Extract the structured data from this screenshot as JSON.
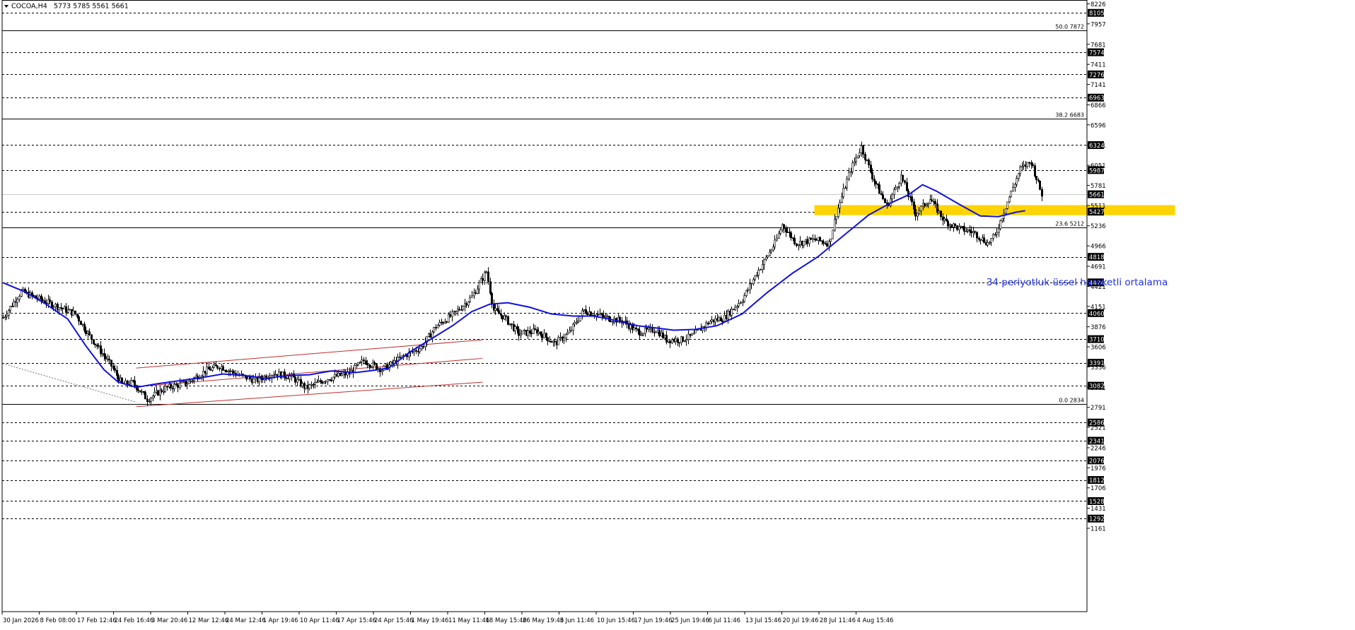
{
  "window": {
    "title": "COCOA,H4",
    "ohlc": "5773 5785 5561 5661"
  },
  "annotation": "34 periyotluk üssel hareketli ortalama",
  "colors": {
    "ema": "#1010e0",
    "channel": "#c03030",
    "zone": "#ffd400",
    "candle": "#000000",
    "annotation": "#2030e0"
  },
  "chart_data": {
    "type": "candlestick",
    "symbol": "COCOA",
    "timeframe": "H4",
    "ylim": [
      1161,
      8226
    ],
    "price_ticks": [
      8226,
      7957,
      7681,
      7411,
      7141,
      6866,
      6596,
      6321,
      6051,
      5781,
      5511,
      5236,
      4966,
      4691,
      4421,
      4151,
      3876,
      3606,
      3336,
      3061,
      2791,
      2521,
      2246,
      1976,
      1706,
      1431,
      1161
    ],
    "horizontal_levels": [
      8105,
      7574,
      7276,
      6963,
      6324,
      5987,
      5427,
      4818,
      4474,
      4060,
      3710,
      3391,
      3082,
      2586,
      2341,
      2076,
      1812,
      1528,
      1292
    ],
    "current_price": 5661,
    "fibonacci": [
      {
        "label": "50.0 7872",
        "value": 7872
      },
      {
        "label": "38.2 6683",
        "value": 6683
      },
      {
        "label": "23.6 5212",
        "value": 5212
      },
      {
        "label": "0.0 2834",
        "value": 2834
      }
    ],
    "x_labels": [
      "30 Jan 2026",
      "8 Feb 08:00",
      "17 Feb 12:46",
      "24 Feb 16:46",
      "3 Mar 20:46",
      "12 Mar 12:46",
      "24 Mar 12:46",
      "1 Apr 19:46",
      "10 Apr 11:46",
      "17 Apr 15:46",
      "24 Apr 15:46",
      "1 May 19:46",
      "11 May 11:46",
      "18 May 15:46",
      "26 May 19:46",
      "3 Jun 11:46",
      "10 Jun 15:46",
      "17 Jun 19:46",
      "25 Jun 19:46",
      "6 Jul 11:46",
      "13 Jul 15:46",
      "20 Jul 19:46",
      "28 Jul 11:46",
      "4 Aug 15:46"
    ],
    "price_path": [
      [
        0,
        4000
      ],
      [
        10,
        4350
      ],
      [
        20,
        4250
      ],
      [
        30,
        4150
      ],
      [
        40,
        4050
      ],
      [
        48,
        3750
      ],
      [
        60,
        3350
      ],
      [
        66,
        3100
      ],
      [
        72,
        3120
      ],
      [
        80,
        2900
      ],
      [
        90,
        3050
      ],
      [
        102,
        3120
      ],
      [
        112,
        3280
      ],
      [
        120,
        3350
      ],
      [
        130,
        3230
      ],
      [
        140,
        3150
      ],
      [
        150,
        3250
      ],
      [
        160,
        3200
      ],
      [
        168,
        3050
      ],
      [
        180,
        3180
      ],
      [
        192,
        3250
      ],
      [
        200,
        3420
      ],
      [
        210,
        3300
      ],
      [
        216,
        3380
      ],
      [
        222,
        3480
      ],
      [
        232,
        3600
      ],
      [
        240,
        3880
      ],
      [
        250,
        4050
      ],
      [
        260,
        4280
      ],
      [
        268,
        4620
      ],
      [
        272,
        4100
      ],
      [
        278,
        4000
      ],
      [
        286,
        3780
      ],
      [
        296,
        3820
      ],
      [
        306,
        3650
      ],
      [
        314,
        3800
      ],
      [
        322,
        4100
      ],
      [
        334,
        4000
      ],
      [
        344,
        3950
      ],
      [
        352,
        3800
      ],
      [
        362,
        3840
      ],
      [
        368,
        3700
      ],
      [
        376,
        3700
      ],
      [
        382,
        3750
      ],
      [
        392,
        3950
      ],
      [
        400,
        4000
      ],
      [
        410,
        4250
      ],
      [
        418,
        4600
      ],
      [
        428,
        5000
      ],
      [
        432,
        5250
      ],
      [
        440,
        5000
      ],
      [
        450,
        5050
      ],
      [
        458,
        5000
      ],
      [
        462,
        5400
      ],
      [
        470,
        6000
      ],
      [
        476,
        6300
      ],
      [
        482,
        5900
      ],
      [
        490,
        5500
      ],
      [
        498,
        5900
      ],
      [
        506,
        5400
      ],
      [
        514,
        5600
      ],
      [
        522,
        5300
      ],
      [
        530,
        5200
      ],
      [
        538,
        5150
      ],
      [
        546,
        5000
      ],
      [
        550,
        5100
      ],
      [
        556,
        5500
      ],
      [
        564,
        6000
      ],
      [
        570,
        6100
      ],
      [
        574,
        5800
      ],
      [
        576,
        5661
      ]
    ],
    "ema_34": [
      [
        0,
        4470
      ],
      [
        12,
        4350
      ],
      [
        24,
        4180
      ],
      [
        36,
        3980
      ],
      [
        46,
        3620
      ],
      [
        56,
        3300
      ],
      [
        64,
        3130
      ],
      [
        74,
        3060
      ],
      [
        86,
        3110
      ],
      [
        98,
        3150
      ],
      [
        110,
        3190
      ],
      [
        122,
        3240
      ],
      [
        134,
        3220
      ],
      [
        146,
        3180
      ],
      [
        158,
        3220
      ],
      [
        170,
        3230
      ],
      [
        182,
        3280
      ],
      [
        196,
        3260
      ],
      [
        206,
        3290
      ],
      [
        214,
        3320
      ],
      [
        226,
        3540
      ],
      [
        238,
        3720
      ],
      [
        250,
        3900
      ],
      [
        260,
        4080
      ],
      [
        270,
        4180
      ],
      [
        280,
        4200
      ],
      [
        292,
        4140
      ],
      [
        304,
        4050
      ],
      [
        316,
        4020
      ],
      [
        328,
        4020
      ],
      [
        340,
        3960
      ],
      [
        352,
        3890
      ],
      [
        362,
        3860
      ],
      [
        372,
        3830
      ],
      [
        384,
        3840
      ],
      [
        396,
        3890
      ],
      [
        410,
        4050
      ],
      [
        424,
        4340
      ],
      [
        438,
        4600
      ],
      [
        452,
        4820
      ],
      [
        466,
        5100
      ],
      [
        480,
        5380
      ],
      [
        492,
        5540
      ],
      [
        502,
        5650
      ],
      [
        510,
        5790
      ],
      [
        518,
        5700
      ],
      [
        530,
        5530
      ],
      [
        542,
        5370
      ],
      [
        552,
        5360
      ],
      [
        562,
        5420
      ],
      [
        567,
        5440
      ]
    ],
    "ema_label": "34 periyotluk üssel hareketli ortalama",
    "support_zone": {
      "from": 5380,
      "to": 5515,
      "x_start": 450,
      "x_end": 650
    },
    "channel": {
      "upper": [
        [
          74,
          3320
        ],
        [
          266,
          3700
        ]
      ],
      "middle": [
        [
          74,
          3070
        ],
        [
          266,
          3450
        ]
      ],
      "lower": [
        [
          74,
          2800
        ],
        [
          266,
          3130
        ]
      ]
    },
    "dotted_trend": [
      [
        0,
        3380
      ],
      [
        74,
        2860
      ]
    ],
    "grid": false
  }
}
